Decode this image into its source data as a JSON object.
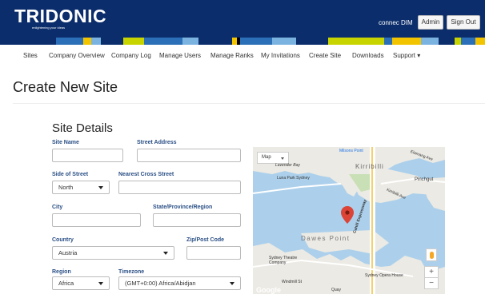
{
  "header": {
    "brand": "TRIDONIC",
    "tagline": "enlightening your ideas",
    "user": "connec DIM",
    "admin_label": "Admin",
    "signout_label": "Sign Out"
  },
  "nav": {
    "items": [
      "Sites",
      "Company Overview",
      "Company Log",
      "Manage Users",
      "Manage Ranks",
      "My Invitations",
      "Create Site",
      "Downloads",
      "Support ▾"
    ]
  },
  "page": {
    "title": "Create New Site",
    "section_title": "Site Details"
  },
  "form": {
    "site_name": {
      "label": "Site Name",
      "value": ""
    },
    "street_address": {
      "label": "Street Address",
      "value": ""
    },
    "side_of_street": {
      "label": "Side of Street",
      "value": "North"
    },
    "nearest_cross_street": {
      "label": "Nearest Cross Street",
      "value": ""
    },
    "city": {
      "label": "City",
      "value": ""
    },
    "state": {
      "label": "State/Province/Region",
      "value": ""
    },
    "country": {
      "label": "Country",
      "value": "Austria"
    },
    "zip": {
      "label": "Zip/Post Code",
      "value": ""
    },
    "region": {
      "label": "Region",
      "value": "Africa"
    },
    "timezone": {
      "label": "Timezone",
      "value": "(GMT+0:00) Africa/Abidjan"
    }
  },
  "map": {
    "type_label": "Map",
    "places": {
      "milsons": "Milsons Point",
      "lavender": "Lavender Bay",
      "lunapark": "Luna Park Sydney",
      "kirribilli": "Kirribilli",
      "pinchgut": "Pinchgut",
      "kirribilli_ave": "Kirribilli Ave",
      "elamang": "Elamang Ave",
      "cahill": "Cahill Expressway",
      "dawes": "Dawes Point",
      "theatre": "Sydney Theatre Company",
      "opera": "Sydney Opera House",
      "windmill": "Windmill St",
      "quay": "Quay"
    },
    "zoom_in": "+",
    "zoom_out": "−",
    "google": "Google"
  },
  "colors": {
    "header_bg": "#0b2d6b",
    "label": "#2a4f85",
    "water": "#acd0eb",
    "marker": "#db4437"
  }
}
